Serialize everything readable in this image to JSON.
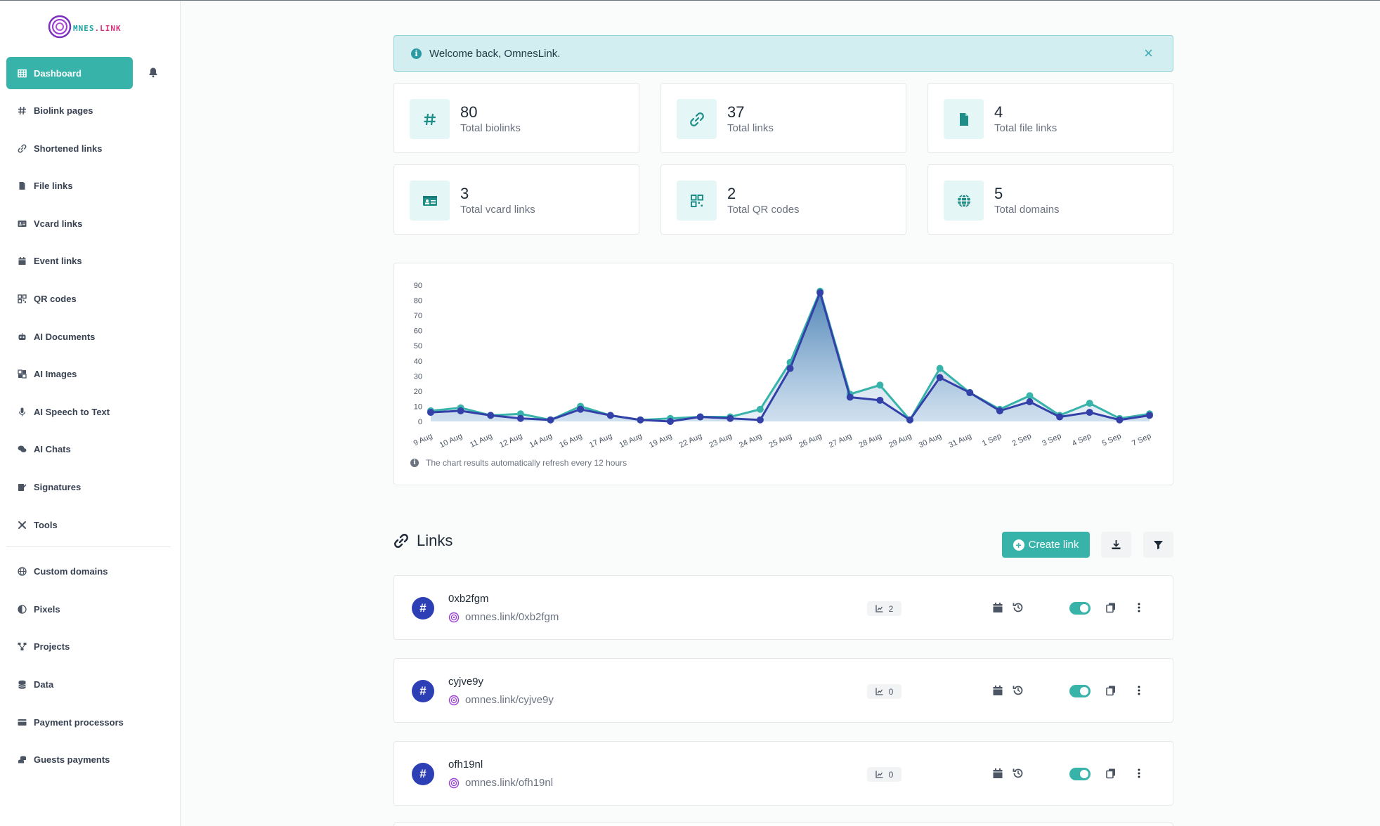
{
  "app": {
    "logo_prefix": "MNES",
    "logo_suffix": ".LINK",
    "colors": {
      "accent": "#37b3aa",
      "primary_avatar": "#2d3fb5",
      "series_a": "#37b3aa",
      "series_b": "#3340a8"
    }
  },
  "sidebar": {
    "items": [
      {
        "label": "Dashboard",
        "icon": "grid-icon"
      },
      {
        "label": "Biolink pages",
        "icon": "hash-icon"
      },
      {
        "label": "Shortened links",
        "icon": "link-icon"
      },
      {
        "label": "File links",
        "icon": "file-icon"
      },
      {
        "label": "Vcard links",
        "icon": "id-card-icon"
      },
      {
        "label": "Event links",
        "icon": "calendar-icon"
      },
      {
        "label": "QR codes",
        "icon": "qrcode-icon"
      },
      {
        "label": "AI Documents",
        "icon": "robot-icon"
      },
      {
        "label": "AI Images",
        "icon": "image-icon"
      },
      {
        "label": "AI Speech to Text",
        "icon": "microphone-icon"
      },
      {
        "label": "AI Chats",
        "icon": "comments-icon"
      },
      {
        "label": "Signatures",
        "icon": "signature-icon"
      },
      {
        "label": "Tools",
        "icon": "tools-icon"
      }
    ],
    "items2": [
      {
        "label": "Custom domains",
        "icon": "globe-icon"
      },
      {
        "label": "Pixels",
        "icon": "adjust-icon"
      },
      {
        "label": "Projects",
        "icon": "project-icon"
      },
      {
        "label": "Data",
        "icon": "database-icon"
      },
      {
        "label": "Payment processors",
        "icon": "credit-card-icon"
      },
      {
        "label": "Guests payments",
        "icon": "coins-icon"
      }
    ]
  },
  "alert": {
    "message": "Welcome back, OmnesLink.",
    "close": "×"
  },
  "stats": [
    {
      "value": "80",
      "label": "Total biolinks",
      "icon": "hash-icon"
    },
    {
      "value": "37",
      "label": "Total links",
      "icon": "link-icon"
    },
    {
      "value": "4",
      "label": "Total file links",
      "icon": "file-icon"
    },
    {
      "value": "3",
      "label": "Total vcard links",
      "icon": "id-card-icon"
    },
    {
      "value": "2",
      "label": "Total QR codes",
      "icon": "qrcode-icon"
    },
    {
      "value": "5",
      "label": "Total domains",
      "icon": "globe-icon"
    }
  ],
  "chart_note": "The chart results automatically refresh every 12 hours",
  "chart_data": {
    "type": "area",
    "categories": [
      "9 Aug",
      "10 Aug",
      "11 Aug",
      "12 Aug",
      "14 Aug",
      "16 Aug",
      "17 Aug",
      "18 Aug",
      "19 Aug",
      "22 Aug",
      "23 Aug",
      "24 Aug",
      "25 Aug",
      "26 Aug",
      "27 Aug",
      "28 Aug",
      "29 Aug",
      "30 Aug",
      "31 Aug",
      "1 Sep",
      "2 Sep",
      "3 Sep",
      "4 Sep",
      "5 Sep",
      "7 Sep"
    ],
    "series": [
      {
        "values": [
          7,
          9,
          4,
          5,
          1,
          10,
          4,
          1,
          2,
          3,
          3,
          8,
          39,
          86,
          18,
          24,
          1,
          35,
          19,
          8,
          17,
          4,
          12,
          2,
          5
        ]
      },
      {
        "values": [
          6,
          7,
          4,
          2,
          1,
          8,
          4,
          1,
          0,
          3,
          2,
          1,
          35,
          85,
          16,
          14,
          1,
          29,
          19,
          7,
          13,
          3,
          6,
          1,
          4
        ]
      }
    ],
    "ylim": [
      0,
      90
    ],
    "yticks": [
      0,
      10,
      20,
      30,
      40,
      50,
      60,
      70,
      80,
      90
    ],
    "grid": false
  },
  "links_section": {
    "title": "Links",
    "create_label": "Create link",
    "download_icon": "download-icon",
    "filter_icon": "filter-icon"
  },
  "links": [
    {
      "name": "0xb2fgm",
      "url": "omnes.link/0xb2fgm",
      "stats": "2"
    },
    {
      "name": "cyjve9y",
      "url": "omnes.link/cyjve9y",
      "stats": "0"
    },
    {
      "name": "ofh19nl",
      "url": "omnes.link/ofh19nl",
      "stats": "0"
    }
  ]
}
